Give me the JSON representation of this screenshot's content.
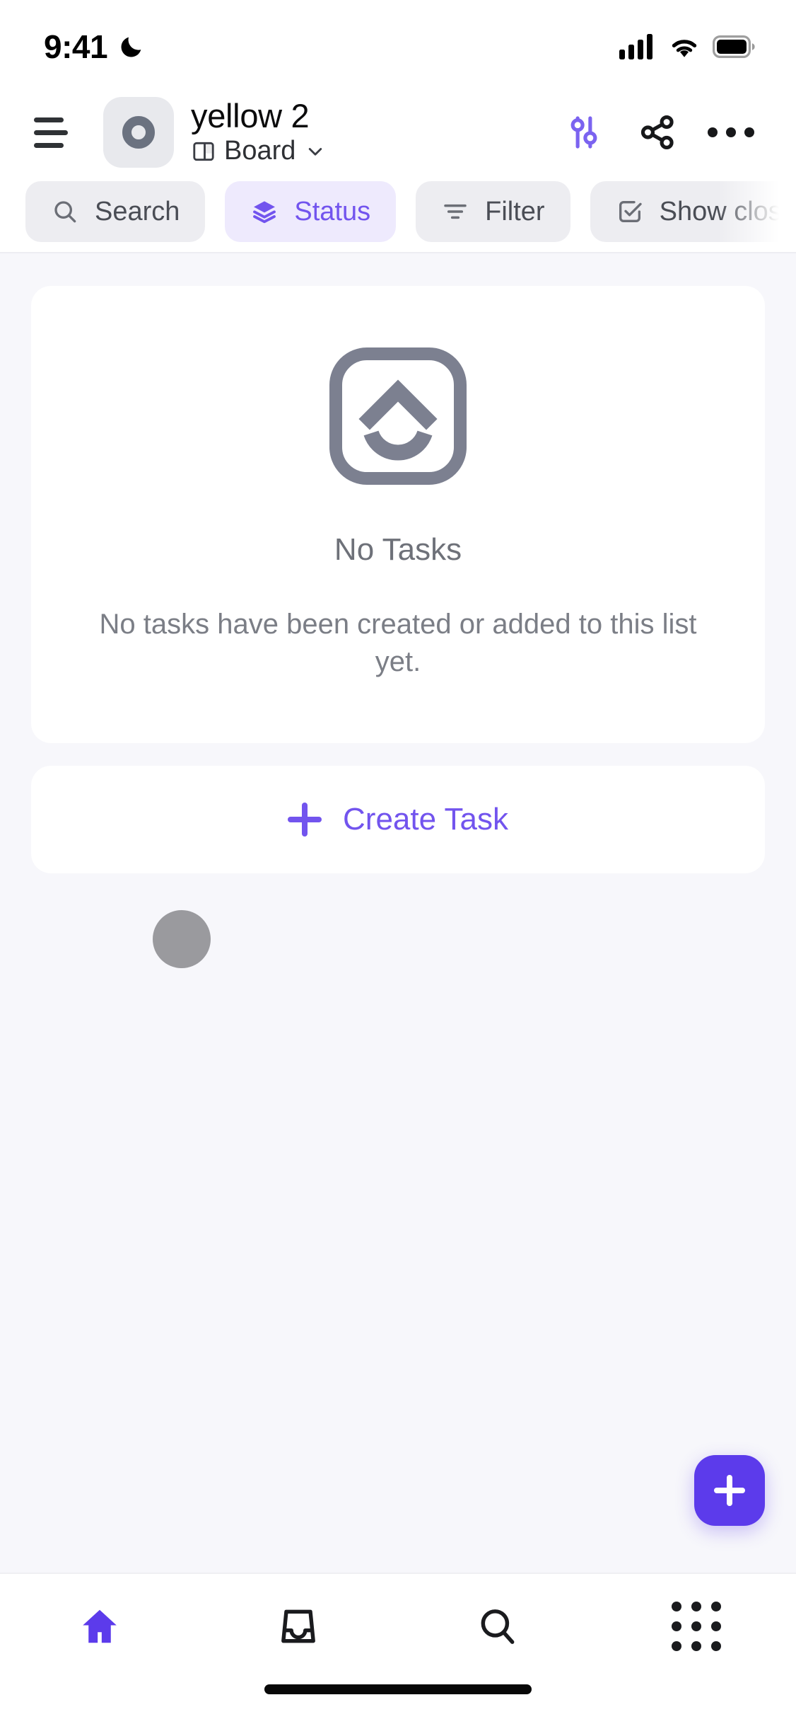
{
  "status_bar": {
    "time": "9:41",
    "dnd_icon": "moon-icon",
    "signal_icon": "cellular-signal-icon",
    "wifi_icon": "wifi-icon",
    "battery_icon": "battery-full-icon"
  },
  "header": {
    "menu_icon": "hamburger-menu-icon",
    "avatar_icon": "workspace-ring-icon",
    "title": "yellow 2",
    "view_icon": "board-view-icon",
    "view_label": "Board",
    "view_chevron_icon": "chevron-down-icon",
    "settings_icon": "sliders-icon",
    "share_icon": "share-icon",
    "more_icon": "more-horizontal-icon"
  },
  "chips": [
    {
      "label": "Search",
      "icon": "search-icon",
      "active": false
    },
    {
      "label": "Status",
      "icon": "layers-icon",
      "active": true
    },
    {
      "label": "Filter",
      "icon": "filter-icon",
      "active": false
    },
    {
      "label": "Show closed",
      "icon": "check-square-icon",
      "active": false,
      "clipped": true
    }
  ],
  "main": {
    "empty_state": {
      "illustration_icon": "clickup-logo-icon",
      "title": "No Tasks",
      "description": "No tasks have been created or added to this list yet."
    },
    "assignee_dot_icon": "assignee-avatar-dot",
    "create_task": {
      "plus_icon": "plus-icon",
      "label": "Create Task"
    },
    "fab": {
      "icon": "plus-icon"
    }
  },
  "bottom_nav": [
    {
      "icon": "home-icon",
      "active": true
    },
    {
      "icon": "inbox-icon",
      "active": false
    },
    {
      "icon": "search-icon",
      "active": false
    },
    {
      "icon": "apps-grid-icon",
      "active": false
    }
  ],
  "colors": {
    "accent_purple": "#7254EE",
    "fab_purple": "#5C3BEB",
    "chip_bg": "#EDEDF1",
    "chip_active_bg": "#EEEAFD",
    "page_bg": "#F7F7FB",
    "card_bg": "#FFFFFF",
    "text_primary": "#0B0B0C",
    "text_muted": "#7B7E86"
  }
}
